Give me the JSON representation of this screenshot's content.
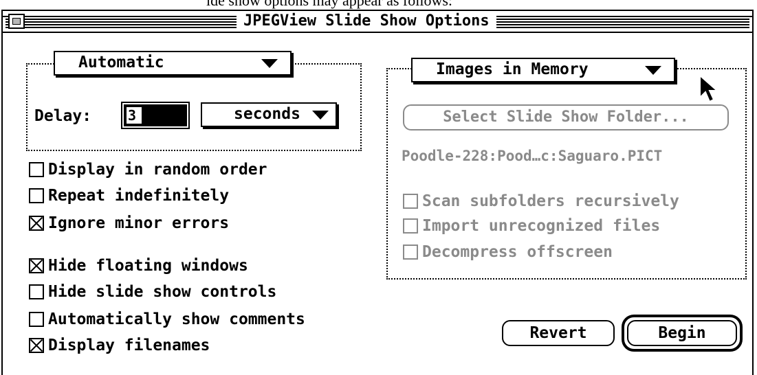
{
  "caption": "ide show options may appear as follows:",
  "window": {
    "title": "JPEGView Slide Show Options"
  },
  "timing": {
    "mode": "Automatic",
    "delay_label": "Delay:",
    "delay_value": "3",
    "delay_unit": "seconds"
  },
  "left_checkboxes": [
    {
      "label": "Display in random order",
      "checked": false
    },
    {
      "label": "Repeat indefinitely",
      "checked": false
    },
    {
      "label": "Ignore minor errors",
      "checked": true
    },
    {
      "label": "Hide floating windows",
      "checked": true
    },
    {
      "label": "Hide slide show controls",
      "checked": false
    },
    {
      "label": "Automatically show comments",
      "checked": false
    },
    {
      "label": "Display filenames",
      "checked": true
    }
  ],
  "source": {
    "mode": "Images in Memory",
    "select_folder_label": "Select Slide Show Folder...",
    "folder_path": "Poodle-228:Pood…c:Saguaro.PICT",
    "options": [
      {
        "label": "Scan subfolders recursively",
        "checked": false
      },
      {
        "label": "Import unrecognized files",
        "checked": false
      },
      {
        "label": "Decompress offscreen",
        "checked": false
      }
    ]
  },
  "buttons": {
    "revert": "Revert",
    "begin": "Begin"
  },
  "colors": {
    "disabled_text": "#8a8a8a",
    "foreground": "#000000",
    "background": "#ffffff"
  },
  "icons": {
    "popup_arrow": "triangle-down",
    "close_box": "square",
    "cursor": "arrow-pointer"
  }
}
